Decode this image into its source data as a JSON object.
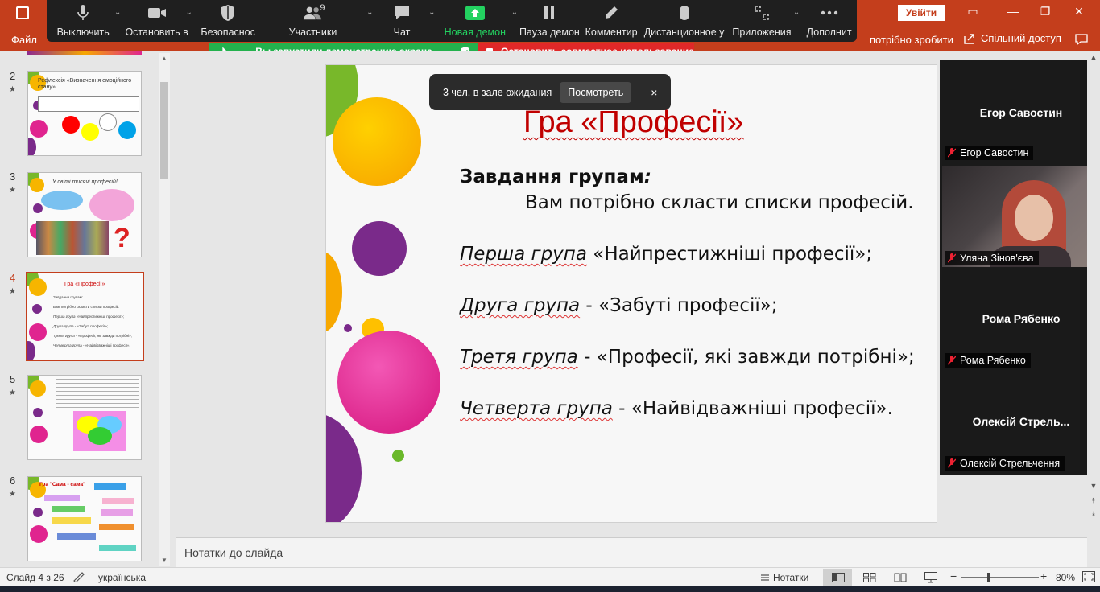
{
  "powerpoint": {
    "file_tab": "Файл",
    "todo_hint": "потрібно зробити",
    "share_label": "Спільний доступ",
    "signin_label": "Увійти",
    "brand_color": "#c43e1c"
  },
  "zoom_toolbar": {
    "buttons": [
      {
        "label": "Выключить",
        "icon": "microphone-icon"
      },
      {
        "label": "Остановить в",
        "icon": "video-camera-icon"
      },
      {
        "label": "Безопаснос",
        "icon": "shield-icon"
      },
      {
        "label": "Участники",
        "icon": "participants-icon",
        "count": "9"
      },
      {
        "label": "Чат",
        "icon": "chat-icon"
      },
      {
        "label": "Новая демон",
        "icon": "share-screen-icon"
      },
      {
        "label": "Пауза демон",
        "icon": "pause-icon"
      },
      {
        "label": "Комментир",
        "icon": "pencil-icon"
      },
      {
        "label": "Дистанционное у",
        "icon": "mouse-icon"
      },
      {
        "label": "Приложения",
        "icon": "apps-icon"
      },
      {
        "label": "Дополнит",
        "icon": "more-icon"
      }
    ],
    "share_color": "#23d160"
  },
  "demo_banner": {
    "status": "Вы запустили демонстрацию экрана",
    "stop": "Остановить совместное использование"
  },
  "waiting_room": {
    "text": "3 чел. в зале ожидания",
    "view_button": "Посмотреть",
    "close": "×"
  },
  "thumbnails": [
    {
      "num": "2",
      "title": "Рефлексія «Визначення емоційного стану»"
    },
    {
      "num": "3",
      "title": "У світі тисячі професій!"
    },
    {
      "num": "4",
      "title": "Гра «Професії»",
      "active": true
    },
    {
      "num": "5",
      "title": ""
    },
    {
      "num": "6",
      "title": "Гра \"Сама - сама\""
    }
  ],
  "slide": {
    "title": "Гра «Професії»",
    "task_bold": "Завдання групам",
    "task_colon": ":",
    "task_text": "Вам  потрібно скласти списки професій.",
    "groups": [
      {
        "name": "Перша група",
        "text": " «Найпрестижніші професії»;"
      },
      {
        "name": "Друга група",
        "text": " - «Забуті професії»;"
      },
      {
        "name": "Третя група",
        "text": " - «Професії, які завжди потрібні»;"
      },
      {
        "name": "Четверта група",
        "text": " - «Найвідважніші професії»."
      }
    ]
  },
  "participants": [
    {
      "name": "Егор Савостин",
      "label": "Егор Савостин",
      "video": false
    },
    {
      "name": "",
      "label": "Уляна Зінов'єва",
      "video": true
    },
    {
      "name": "Рома Рябенко",
      "label": "Рома Рябенко",
      "video": false
    },
    {
      "name": "Олексій  Стрель...",
      "label": "Олексій Стрельчення",
      "video": false
    }
  ],
  "notes_placeholder": "Нотатки до слайда",
  "status_bar": {
    "slide_info": "Слайд 4 з 26",
    "language": "українська",
    "notes_button": "Нотатки",
    "zoom": "80%"
  }
}
